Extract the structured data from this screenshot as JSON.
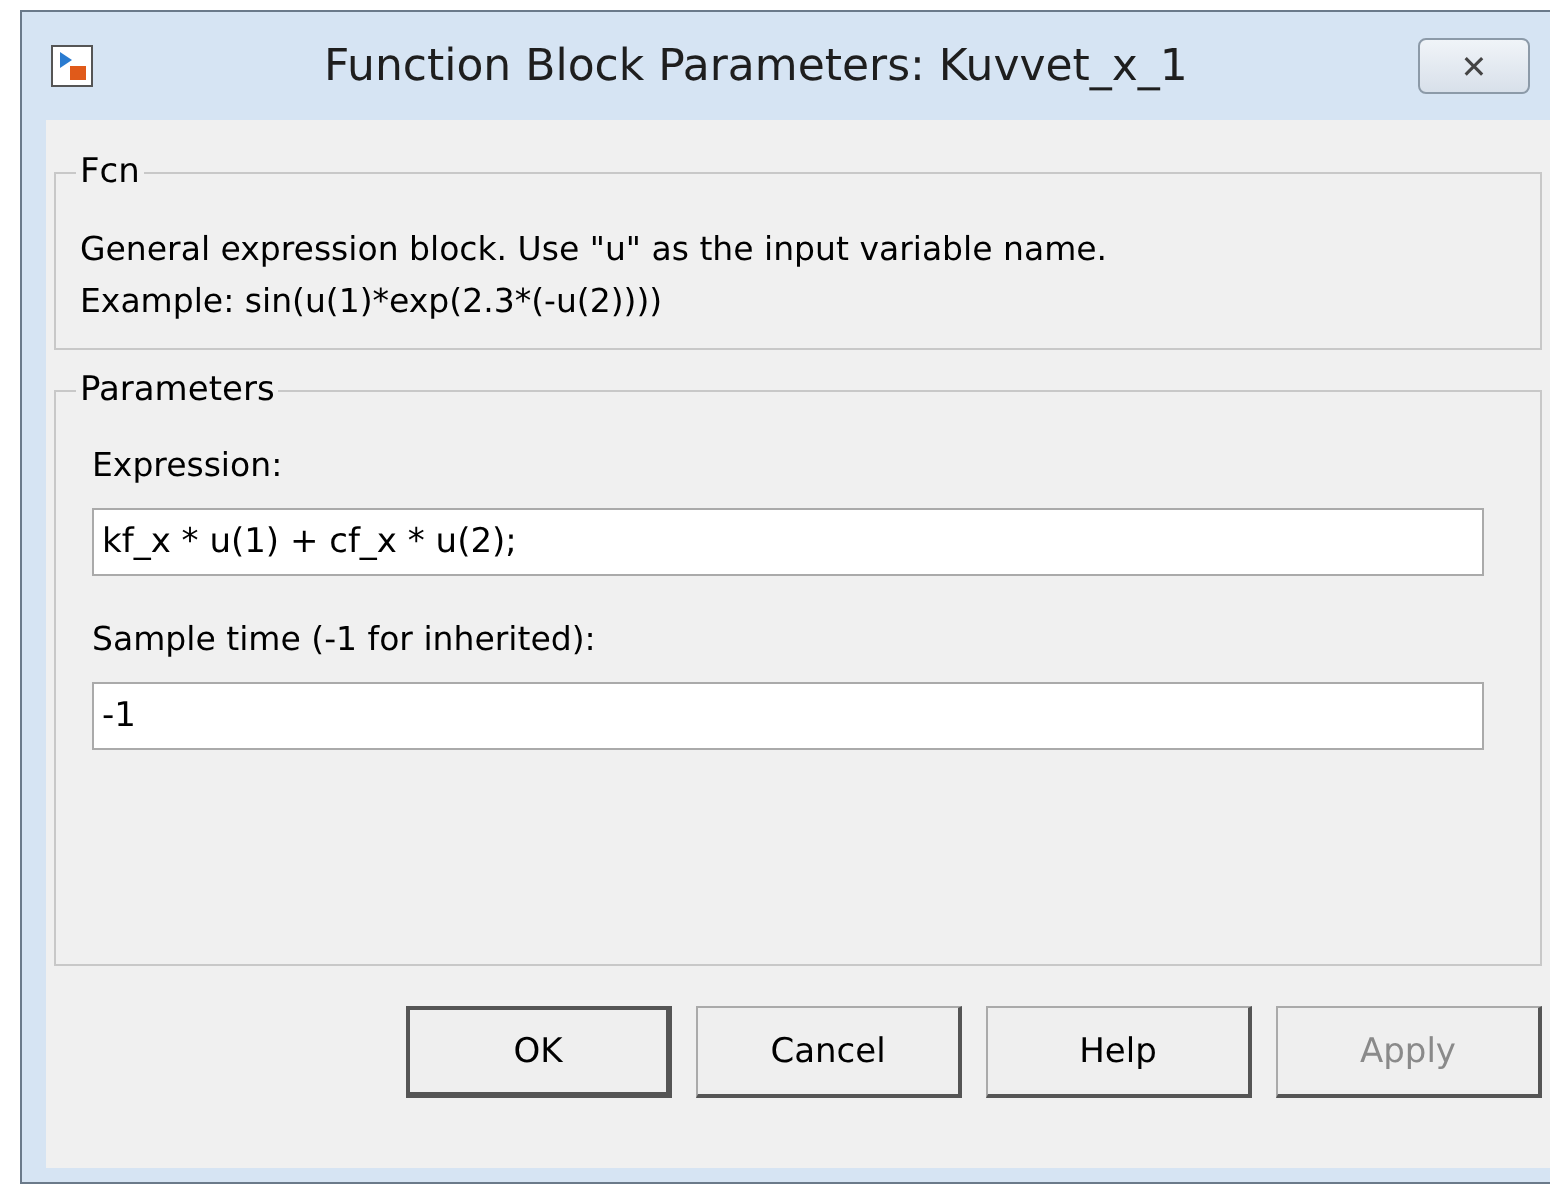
{
  "window": {
    "title": "Function Block Parameters: Kuvvet_x_1",
    "close": "✕"
  },
  "description_group": {
    "title": "Fcn",
    "lines": [
      "General expression block. Use \"u\" as the input variable name.",
      "Example: sin(u(1)*exp(2.3*(-u(2))))"
    ]
  },
  "parameters_group": {
    "title": "Parameters",
    "fields": [
      {
        "label": "Expression:",
        "value": "kf_x * u(1) + cf_x * u(2);"
      },
      {
        "label": "Sample time (-1 for inherited):",
        "value": "-1"
      }
    ]
  },
  "buttons": [
    {
      "label": "OK",
      "default": true,
      "disabled": false
    },
    {
      "label": "Cancel",
      "default": false,
      "disabled": false
    },
    {
      "label": "Help",
      "default": false,
      "disabled": false
    },
    {
      "label": "Apply",
      "default": false,
      "disabled": true
    }
  ]
}
